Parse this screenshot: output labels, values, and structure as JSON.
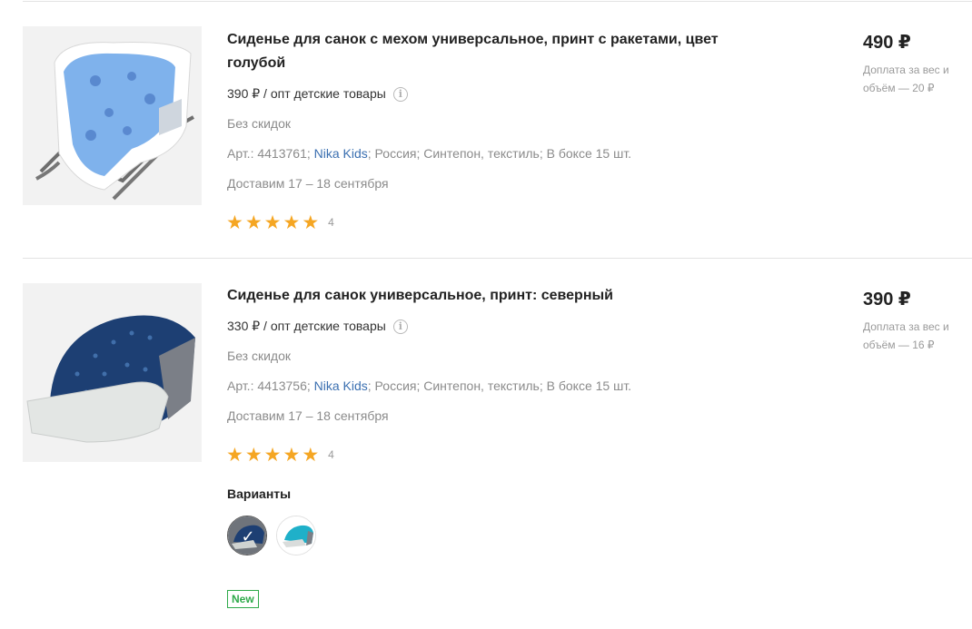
{
  "colors": {
    "accent_link": "#3a6fb0",
    "star": "#f5a623",
    "new_badge": "#2eaa4a",
    "muted": "#8b8b8b"
  },
  "products": [
    {
      "title": "Сиденье для санок с мехом универсальное, принт с ракетами, цвет голубой",
      "wholesale": "390 ₽ / опт детские товары",
      "discount": "Без скидок",
      "sku": "Арт.: 4413761;",
      "brand": "Nika Kids",
      "specs_rest": "; Россия; Синтепон, текстиль; В боксе 15 шт.",
      "delivery": "Доставим 17 – 18 сентября",
      "rating": 5,
      "reviews": "4",
      "price": "490 ₽",
      "surcharge": "Доплата за вес и объём — 20 ₽",
      "image_icon": "sled-seat-fur-blue-icon"
    },
    {
      "title": "Сиденье для санок универсальное, принт: северный",
      "wholesale": "330 ₽ / опт детские товары",
      "discount": "Без скидок",
      "sku": "Арт.: 4413756;",
      "brand": "Nika Kids",
      "specs_rest": "; Россия; Синтепон, текстиль; В боксе 15 шт.",
      "delivery": "Доставим 17 – 18 сентября",
      "rating": 5,
      "reviews": "4",
      "price": "390 ₽",
      "surcharge": "Доплата за вес и объём — 16 ₽",
      "image_icon": "sled-seat-navy-icon",
      "variants_label": "Варианты",
      "variants": [
        {
          "name": "navy",
          "selected": true,
          "check": "✓"
        },
        {
          "name": "turquoise",
          "selected": false
        }
      ],
      "badge": "New"
    }
  ],
  "info_glyph": "i",
  "star_glyph": "★"
}
